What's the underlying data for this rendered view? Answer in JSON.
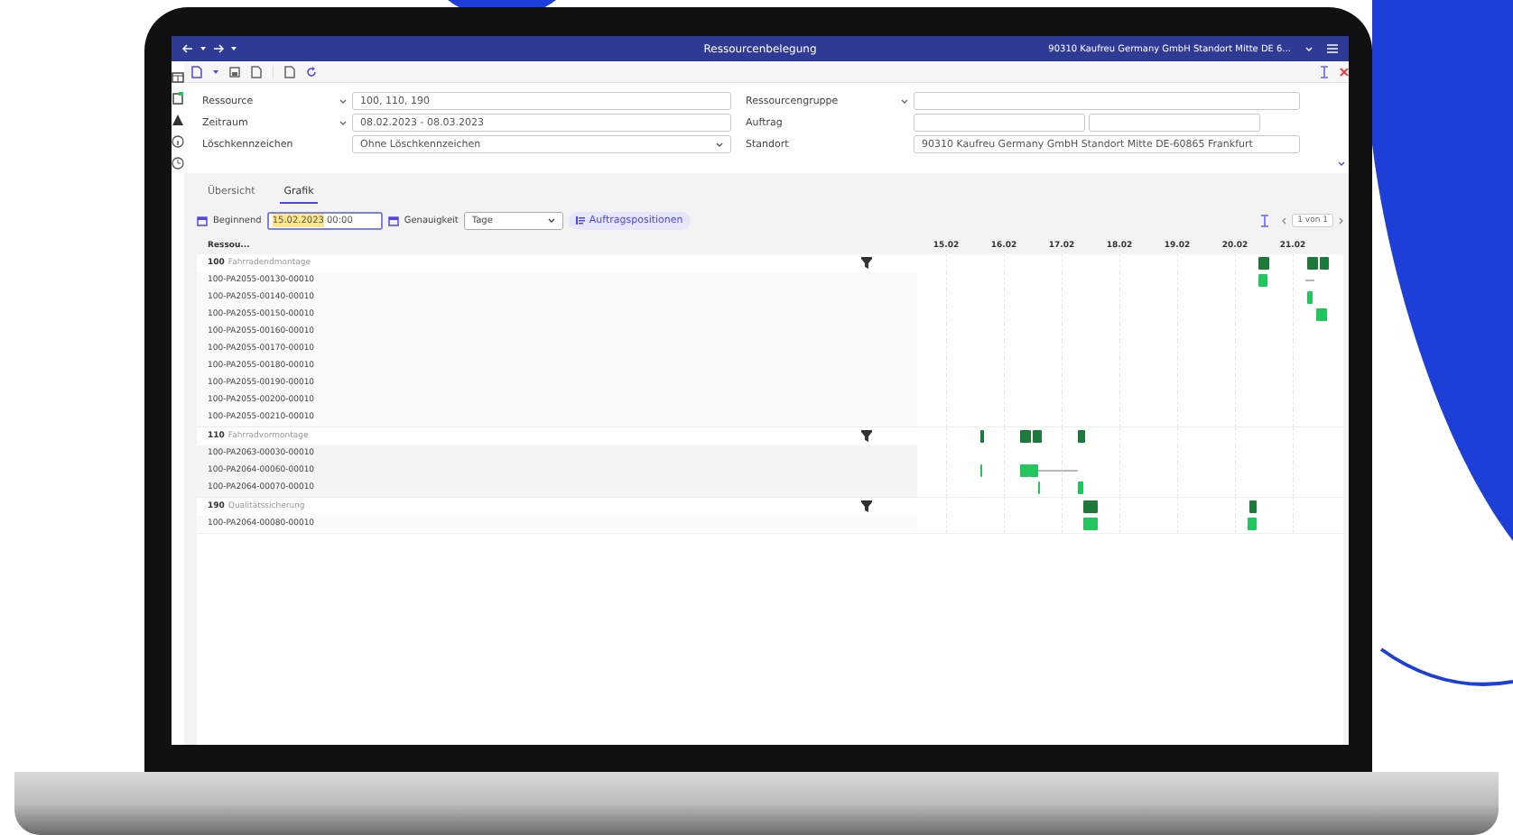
{
  "window": {
    "title": "Ressourcenbelegung",
    "company": "90310 Kaufreu Germany GmbH Standort Mitte DE 6..."
  },
  "form": {
    "left": [
      {
        "label": "Ressource",
        "kind": "combo",
        "value": "100, 110, 190"
      },
      {
        "label": "Zeitraum",
        "kind": "combo",
        "value": "08.02.2023 - 08.03.2023"
      },
      {
        "label": "Löschkennzeichen",
        "kind": "select",
        "value": "Ohne Löschkennzeichen"
      }
    ],
    "right": [
      {
        "label": "Ressourcengruppe",
        "kind": "combo"
      },
      {
        "label": "Auftrag",
        "kind": "split"
      },
      {
        "label": "Standort",
        "kind": "plain",
        "values": [
          "90310 Kaufreu Germany GmbH Standort Mitte DE-60865 Frankfurt"
        ]
      }
    ]
  },
  "tabs": [
    {
      "label": "Übersicht",
      "selected": false
    },
    {
      "label": "Grafik",
      "selected": true
    }
  ],
  "controls": {
    "start_label": "Beginnend",
    "start_date": "15.02.2023",
    "start_time": "00:00",
    "precision_label": "Genauigkeit",
    "precision": "Tage",
    "positions_button": "Auftragspositionen",
    "pager": "1 von 1"
  },
  "gantt": {
    "column_header": "Ressou...",
    "dates": [
      "15.02",
      "16.02",
      "17.02",
      "18.02",
      "19.02",
      "20.02",
      "21.02"
    ],
    "groups": [
      {
        "code": "100",
        "name": "Fahrradendmontage",
        "items": [
          "100-PA2055-00130-00010",
          "100-PA2055-00140-00010",
          "100-PA2055-00150-00010",
          "100-PA2055-00160-00010",
          "100-PA2055-00170-00010",
          "100-PA2055-00180-00010",
          "100-PA2055-00190-00010",
          "100-PA2055-00200-00010",
          "100-PA2055-00210-00010"
        ]
      },
      {
        "code": "110",
        "name": "Fahrradvormontage",
        "items": [
          "100-PA2063-00030-00010",
          "100-PA2064-00060-00010",
          "100-PA2064-00070-00010"
        ]
      },
      {
        "code": "190",
        "name": "Qualitätssicherung",
        "items": [
          "100-PA2064-00080-00010"
        ]
      }
    ]
  }
}
